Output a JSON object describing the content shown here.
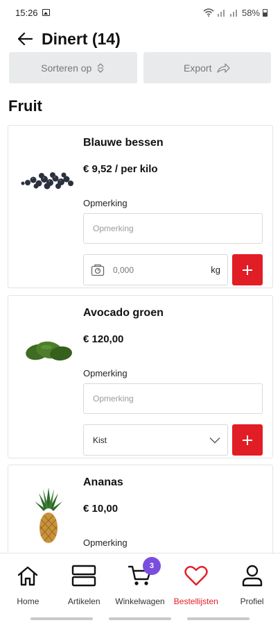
{
  "status_bar": {
    "time": "15:26",
    "battery": "58%"
  },
  "header": {
    "title": "Dinert (14)"
  },
  "toolbar": {
    "sort_label": "Sorteren op",
    "export_label": "Export"
  },
  "section": {
    "title": "Fruit"
  },
  "products": [
    {
      "name": "Blauwe bessen",
      "price": "€ 9,52 / per kilo",
      "note_label": "Opmerking",
      "note_placeholder": "Opmerking",
      "qty_placeholder": "0,000",
      "unit": "kg"
    },
    {
      "name": "Avocado groen",
      "price": "€ 120,00",
      "note_label": "Opmerking",
      "note_placeholder": "Opmerking",
      "selected_unit": "Kist"
    },
    {
      "name": "Ananas",
      "price": "€ 10,00",
      "note_label": "Opmerking"
    }
  ],
  "nav": {
    "items": [
      {
        "label": "Home",
        "icon": "home-icon"
      },
      {
        "label": "Artikelen",
        "icon": "articles-icon"
      },
      {
        "label": "Winkelwagen",
        "icon": "cart-icon",
        "badge": "3"
      },
      {
        "label": "Bestellijsten",
        "icon": "heart-icon",
        "active": true
      },
      {
        "label": "Profiel",
        "icon": "profile-icon"
      }
    ]
  },
  "colors": {
    "accent_red": "#e11d26",
    "badge_purple": "#7b4dde",
    "button_grey": "#e9eaec"
  }
}
